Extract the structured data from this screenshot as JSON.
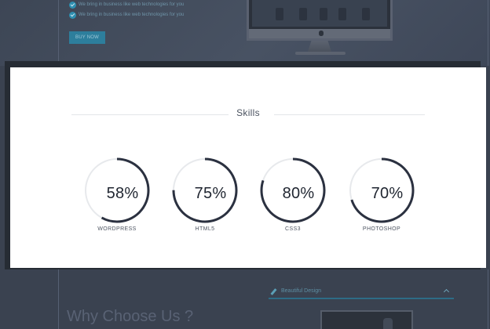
{
  "hero": {
    "features": [
      "We bring in business like web technologies for you",
      "We bring in business like web technologies for you"
    ],
    "buy_label": "BUY NOW"
  },
  "modal": {
    "title": "Skills",
    "skills": [
      {
        "name": "WORDPRESS",
        "percent": 58,
        "label": "58%"
      },
      {
        "name": "HTML5",
        "percent": 75,
        "label": "75%"
      },
      {
        "name": "CSS3",
        "percent": 80,
        "label": "80%"
      },
      {
        "name": "PHOTOSHOP",
        "percent": 70,
        "label": "70%"
      }
    ],
    "ring_color": "#2b3140",
    "track_color": "#e7e9ec"
  },
  "lower": {
    "heading": "Why Choose Us ?",
    "accordion_label": "Beautiful Design"
  },
  "colors": {
    "overlay": "#3a4250",
    "accent": "#2d7e9c"
  },
  "icons": [
    "check-icon",
    "apple-icon",
    "pencil-icon",
    "chevron-up-icon"
  ]
}
